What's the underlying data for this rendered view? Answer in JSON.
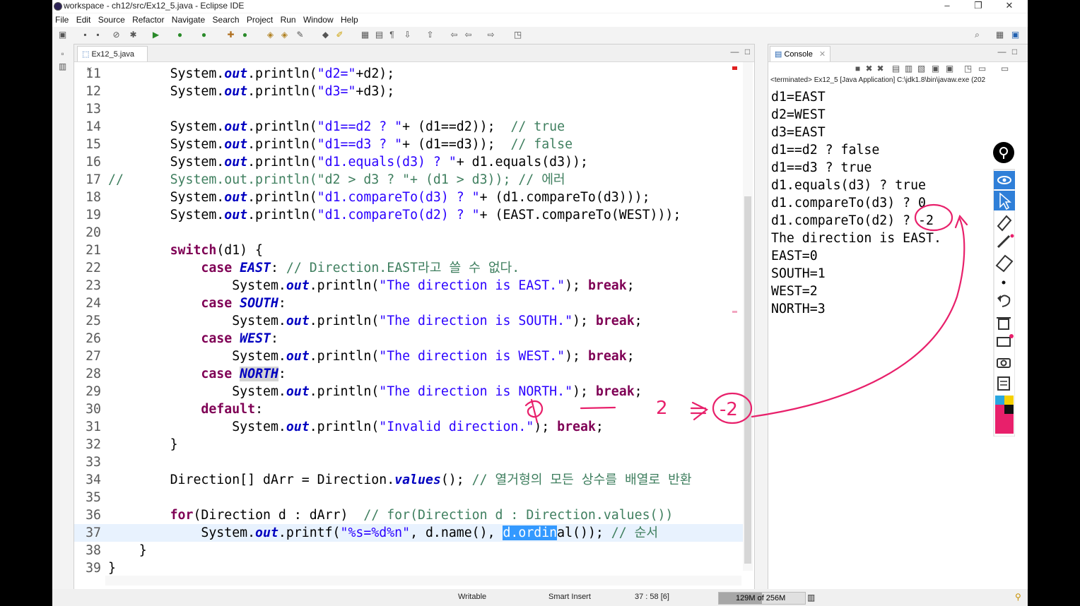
{
  "window": {
    "title": "workspace - ch12/src/Ex12_5.java - Eclipse IDE",
    "minimize": "–",
    "maximize": "❐",
    "close": "✕"
  },
  "menu": [
    "File",
    "Edit",
    "Source",
    "Refactor",
    "Navigate",
    "Search",
    "Project",
    "Run",
    "Window",
    "Help"
  ],
  "editor": {
    "tab_label": "Ex12_5.java",
    "lines": [
      {
        "n": "11",
        "parts": [
          [
            "",
            "        System."
          ],
          [
            "fld",
            "out"
          ],
          [
            "",
            ".println("
          ],
          [
            "str",
            "\"d2=\""
          ],
          [
            "",
            "+d2);"
          ]
        ]
      },
      {
        "n": "12",
        "parts": [
          [
            "",
            "        System."
          ],
          [
            "fld",
            "out"
          ],
          [
            "",
            ".println("
          ],
          [
            "str",
            "\"d3=\""
          ],
          [
            "",
            "+d3);"
          ]
        ]
      },
      {
        "n": "13",
        "parts": []
      },
      {
        "n": "14",
        "parts": [
          [
            "",
            "        System."
          ],
          [
            "fld",
            "out"
          ],
          [
            "",
            ".println("
          ],
          [
            "str",
            "\"d1==d2 ? \""
          ],
          [
            "",
            "+ (d1==d2));  "
          ],
          [
            "cmt",
            "// true"
          ]
        ]
      },
      {
        "n": "15",
        "parts": [
          [
            "",
            "        System."
          ],
          [
            "fld",
            "out"
          ],
          [
            "",
            ".println("
          ],
          [
            "str",
            "\"d1==d3 ? \""
          ],
          [
            "",
            "+ (d1==d3));  "
          ],
          [
            "cmt",
            "// false"
          ]
        ]
      },
      {
        "n": "16",
        "parts": [
          [
            "",
            "        System."
          ],
          [
            "fld",
            "out"
          ],
          [
            "",
            ".println("
          ],
          [
            "str",
            "\"d1.equals(d3) ? \""
          ],
          [
            "",
            "+ d1.equals(d3));"
          ]
        ]
      },
      {
        "n": "17",
        "parts": [
          [
            "cmt",
            "//      System.out.println(\"d2 > d3 ? \"+ (d1 > d3)); // 에러"
          ]
        ]
      },
      {
        "n": "18",
        "parts": [
          [
            "",
            "        System."
          ],
          [
            "fld",
            "out"
          ],
          [
            "",
            ".println("
          ],
          [
            "str",
            "\"d1.compareTo(d3) ? \""
          ],
          [
            "",
            "+ (d1.compareTo(d3)));"
          ]
        ]
      },
      {
        "n": "19",
        "parts": [
          [
            "",
            "        System."
          ],
          [
            "fld",
            "out"
          ],
          [
            "",
            ".println("
          ],
          [
            "str",
            "\"d1.compareTo(d2) ? \""
          ],
          [
            "",
            "+ (EAST.compareTo(WEST)));"
          ]
        ]
      },
      {
        "n": "20",
        "parts": []
      },
      {
        "n": "21",
        "parts": [
          [
            "",
            "        "
          ],
          [
            "kw",
            "switch"
          ],
          [
            "",
            "(d1) {"
          ]
        ]
      },
      {
        "n": "22",
        "parts": [
          [
            "",
            "            "
          ],
          [
            "kw",
            "case"
          ],
          [
            "",
            " "
          ],
          [
            "fld",
            "EAST"
          ],
          [
            "",
            ": "
          ],
          [
            "cmt",
            "// Direction.EAST라고 쓸 수 없다."
          ]
        ]
      },
      {
        "n": "23",
        "parts": [
          [
            "",
            "                System."
          ],
          [
            "fld",
            "out"
          ],
          [
            "",
            ".println("
          ],
          [
            "str",
            "\"The direction is EAST.\""
          ],
          [
            "",
            "); "
          ],
          [
            "kw",
            "break"
          ],
          [
            "",
            ";"
          ]
        ]
      },
      {
        "n": "24",
        "parts": [
          [
            "",
            "            "
          ],
          [
            "kw",
            "case"
          ],
          [
            "",
            " "
          ],
          [
            "fld",
            "SOUTH"
          ],
          [
            "",
            ":"
          ]
        ]
      },
      {
        "n": "25",
        "parts": [
          [
            "",
            "                System."
          ],
          [
            "fld",
            "out"
          ],
          [
            "",
            ".println("
          ],
          [
            "str",
            "\"The direction is SOUTH.\""
          ],
          [
            "",
            "); "
          ],
          [
            "kw",
            "break"
          ],
          [
            "",
            ";"
          ]
        ]
      },
      {
        "n": "26",
        "parts": [
          [
            "",
            "            "
          ],
          [
            "kw",
            "case"
          ],
          [
            "",
            " "
          ],
          [
            "fld",
            "WEST"
          ],
          [
            "",
            ":"
          ]
        ]
      },
      {
        "n": "27",
        "parts": [
          [
            "",
            "                System."
          ],
          [
            "fld",
            "out"
          ],
          [
            "",
            ".println("
          ],
          [
            "str",
            "\"The direction is WEST.\""
          ],
          [
            "",
            "); "
          ],
          [
            "kw",
            "break"
          ],
          [
            "",
            ";"
          ]
        ]
      },
      {
        "n": "28",
        "parts": [
          [
            "",
            "            "
          ],
          [
            "kw",
            "case"
          ],
          [
            "",
            " "
          ],
          [
            "fld hl",
            "NORTH"
          ],
          [
            "",
            ":"
          ]
        ]
      },
      {
        "n": "29",
        "parts": [
          [
            "",
            "                System."
          ],
          [
            "fld",
            "out"
          ],
          [
            "",
            ".println("
          ],
          [
            "str",
            "\"The direction is NORTH.\""
          ],
          [
            "",
            "); "
          ],
          [
            "kw",
            "break"
          ],
          [
            "",
            ";"
          ]
        ]
      },
      {
        "n": "30",
        "parts": [
          [
            "",
            "            "
          ],
          [
            "kw",
            "default"
          ],
          [
            "",
            ":"
          ]
        ]
      },
      {
        "n": "31",
        "parts": [
          [
            "",
            "                System."
          ],
          [
            "fld",
            "out"
          ],
          [
            "",
            ".println("
          ],
          [
            "str",
            "\"Invalid direction.\""
          ],
          [
            "",
            "); "
          ],
          [
            "kw",
            "break"
          ],
          [
            "",
            ";"
          ]
        ]
      },
      {
        "n": "32",
        "parts": [
          [
            "",
            "        }"
          ]
        ]
      },
      {
        "n": "33",
        "parts": []
      },
      {
        "n": "34",
        "parts": [
          [
            "",
            "        Direction[] dArr = Direction."
          ],
          [
            "fld",
            "values"
          ],
          [
            "",
            "(); "
          ],
          [
            "cmt",
            "// 열거형의 모든 상수를 배열로 반환"
          ]
        ]
      },
      {
        "n": "35",
        "parts": []
      },
      {
        "n": "36",
        "parts": [
          [
            "",
            "        "
          ],
          [
            "kw",
            "for"
          ],
          [
            "",
            "(Direction d : dArr)  "
          ],
          [
            "cmt",
            "// for(Direction d : Direction.values())"
          ]
        ]
      },
      {
        "n": "37",
        "current": true,
        "parts": [
          [
            "",
            "            System."
          ],
          [
            "fld",
            "out"
          ],
          [
            "",
            ".printf("
          ],
          [
            "str",
            "\"%s=%d%n\""
          ],
          [
            "",
            ", d.name(), "
          ],
          [
            "sel",
            "d.ordin"
          ],
          [
            "",
            "al()); "
          ],
          [
            "cmt",
            "// 순서"
          ]
        ]
      },
      {
        "n": "38",
        "parts": [
          [
            "",
            "    }"
          ]
        ]
      },
      {
        "n": "39",
        "parts": [
          [
            "",
            "}"
          ]
        ]
      }
    ]
  },
  "console": {
    "tab_label": "Console",
    "status": "<terminated> Ex12_5 [Java Application] C:\\jdk1.8\\bin\\javaw.exe (202",
    "lines": [
      "d1=EAST",
      "d2=WEST",
      "d3=EAST",
      "d1==d2 ? false",
      "d1==d3 ? true",
      "d1.equals(d3) ? true",
      "d1.compareTo(d3) ? 0",
      "d1.compareTo(d2) ? -2",
      "The direction is EAST.",
      "EAST=0",
      "SOUTH=1",
      "WEST=2",
      "NORTH=3"
    ]
  },
  "statusbar": {
    "writable": "Writable",
    "insert_mode": "Smart Insert",
    "position": "37 : 58 [6]",
    "heap": "129M of 256M",
    "heap_used_fraction": 0.5
  },
  "annotations": {
    "handwritten_0": "0",
    "handwritten_2": "2",
    "handwritten_neg2": "-2",
    "color": "#e8206b"
  }
}
